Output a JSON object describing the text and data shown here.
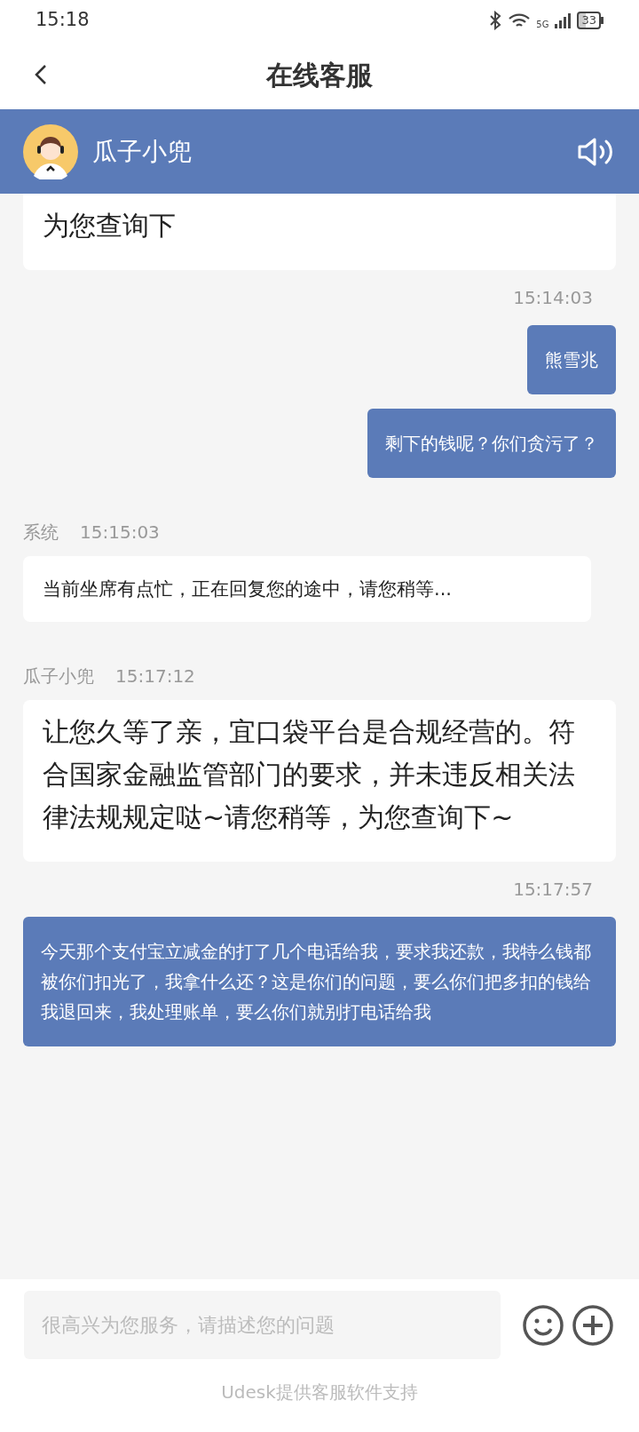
{
  "status_bar": {
    "time": "15:18",
    "network": "5G",
    "battery": "33"
  },
  "title_bar": {
    "title": "在线客服"
  },
  "agent_bar": {
    "name": "瓜子小兜"
  },
  "messages": [
    {
      "kind": "agent",
      "text": "为您查询下"
    },
    {
      "kind": "time",
      "text": "15:14:03"
    },
    {
      "kind": "user",
      "text": "熊雪兆"
    },
    {
      "kind": "user",
      "text": "剩下的钱呢？你们贪污了？"
    },
    {
      "kind": "system",
      "sender": "系统",
      "time": "15:15:03",
      "text": "当前坐席有点忙，正在回复您的途中，请您稍等..."
    },
    {
      "kind": "agent",
      "sender": "瓜子小兜",
      "time": "15:17:12",
      "text": "让您久等了亲，宜口袋平台是合规经营的。符合国家金融监管部门的要求，并未违反相关法律法规规定哒~请您稍等，为您查询下~"
    },
    {
      "kind": "time",
      "text": "15:17:57"
    },
    {
      "kind": "user",
      "text": "今天那个支付宝立减金的打了几个电话给我，要求我还款，我特么钱都被你们扣光了，我拿什么还？这是你们的问题，要么你们把多扣的钱给我退回来，我处理账单，要么你们就别打电话给我"
    }
  ],
  "input": {
    "placeholder": "很高兴为您服务，请描述您的问题"
  },
  "footer": "Udesk提供客服软件支持"
}
